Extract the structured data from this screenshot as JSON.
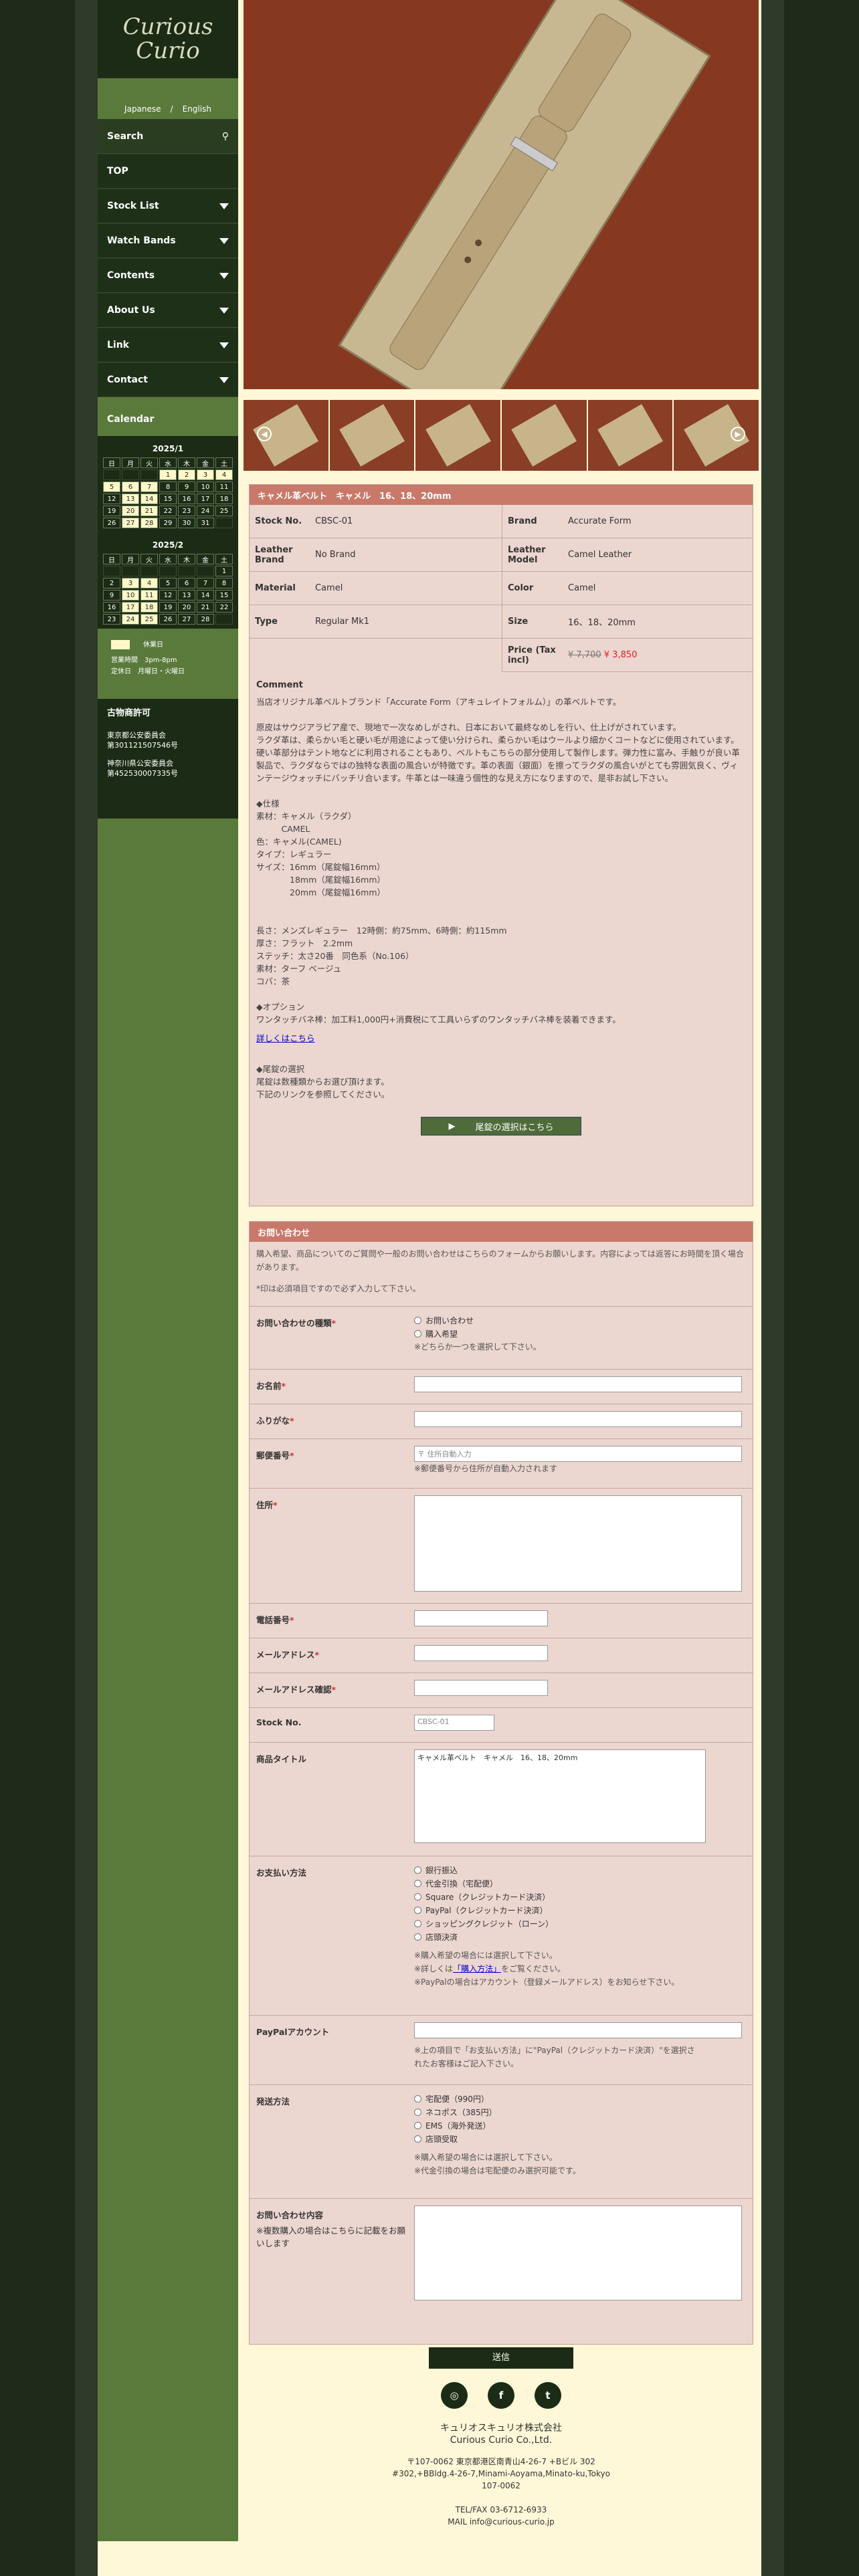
{
  "brand": {
    "line1": "Curious",
    "line2": "Curio"
  },
  "lang": {
    "ja": "Japanese",
    "sep": "/",
    "en": "English"
  },
  "nav": {
    "search": "Search",
    "top": "TOP",
    "stock": "Stock List",
    "watchbands": "Watch Bands",
    "contents": "Contents",
    "about": "About Us",
    "link": "Link",
    "contact": "Contact"
  },
  "calendar": {
    "heading": "Calendar",
    "month1": "2025/1",
    "month2": "2025/2",
    "weekdays": [
      "日",
      "月",
      "火",
      "水",
      "木",
      "金",
      "土"
    ],
    "m1": [
      "",
      "",
      "",
      "1",
      "2",
      "3",
      "4",
      "5",
      "6",
      "7",
      "8",
      "9",
      "10",
      "11",
      "12",
      "13",
      "14",
      "15",
      "16",
      "17",
      "18",
      "19",
      "20",
      "21",
      "22",
      "23",
      "24",
      "25",
      "26",
      "27",
      "28",
      "29",
      "30",
      "31",
      ""
    ],
    "m2": [
      "",
      "",
      "",
      "",
      "",
      "",
      "1",
      "2",
      "3",
      "4",
      "5",
      "6",
      "7",
      "8",
      "9",
      "10",
      "11",
      "12",
      "13",
      "14",
      "15",
      "16",
      "17",
      "18",
      "19",
      "20",
      "21",
      "22",
      "23",
      "24",
      "25",
      "26",
      "27",
      "28",
      ""
    ],
    "legend_holiday": "休業日",
    "hours_label": "営業時間",
    "hours": "3pm-8pm",
    "closed_label": "定休日",
    "closed": "月曜日・火曜日"
  },
  "kobutsu": {
    "title": "古物商許可",
    "l1": "東京都公安委員会",
    "l2": "第301121507546号",
    "l3": "神奈川県公安委員会",
    "l4": "第452530007335号"
  },
  "product": {
    "title": "キャメル革ベルト　キャメル　16、18、20mm",
    "stock_no_k": "Stock No.",
    "stock_no": "CBSC-01",
    "brand_k": "Brand",
    "brand": "Accurate Form",
    "leather_brand_k": "Leather Brand",
    "leather_brand": "No Brand",
    "leather_model_k": "Leather Model",
    "leather_model": "Camel Leather",
    "material_k": "Material",
    "material": "Camel",
    "color_k": "Color",
    "color": "Camel",
    "type_k": "Type",
    "type": "Regular Mk1",
    "size_k": "Size",
    "size": "16、18、20mm",
    "price_k": "Price (Tax incl)",
    "price_old": "¥ 7,700",
    "price_new": "¥ 3,850",
    "comment_h": "Comment",
    "comment": "当店オリジナル革ベルトブランド「Accurate Form（アキュレイトフォルム）」の革ベルトです。\n\n原皮はサウジアラビア産で、現地で一次なめしがされ、日本において最終なめしを行い、仕上げがされています。\nラクダ革は、柔らかい毛と硬い毛が用途によって使い分けられ、柔らかい毛はウールより細かくコートなどに使用されています。硬い革部分はテント地などに利用されることもあり、ベルトもこちらの部分使用して製作します。弾力性に富み、手触りが良い革製品で、ラクダならではの独特な表面の風合いが特徴です。革の表面（銀面）を擦ってラクダの風合いがとても雰囲気良く、ヴィンテージウォッチにバッチリ合います。牛革とは一味違う個性的な見え方になりますので、是非お試し下さい。\n\n◆仕様\n素材：キャメル（ラクダ）\n　　　CAMEL\n色：キャメル(CAMEL)\nタイプ：レギュラー\nサイズ：16mm（尾錠幅16mm）\n　　　　18mm（尾錠幅16mm）\n　　　　20mm（尾錠幅16mm）\n\n\n長さ：メンズレギュラー　12時側：約75mm、6時側：約115mm\n厚さ：フラット　2.2mm\nステッチ：太さ20番　同色系（No.106）\n素材：ターフ ベージュ\nコバ：茶\n\n◆オプション\nワンタッチバネ棒：加工料1,000円+消費税にて工具いらずのワンタッチバネ棒を装着できます。",
    "detail_link": "詳しくはこちら",
    "buckle": "◆尾錠の選択\n尾錠は数種類からお選び頂けます。\n下記のリンクを参照してください。",
    "buckle_btn": "尾錠の選択はこちら"
  },
  "form": {
    "heading": "お問い合わせ",
    "intro": "購入希望、商品についてのご質問や一般のお問い合わせはこちらのフォームからお願いします。内容によっては返答にお時間を頂く場合があります。",
    "req_note": "*印は必須項目ですので必ず入力して下さい。",
    "type_label": "お問い合わせの種類",
    "type_opt1": "お問い合わせ",
    "type_opt2": "購入希望",
    "type_note": "※どちらか一つを選択して下さい。",
    "name_label": "お名前",
    "kana_label": "ふりがな",
    "zip_label": "郵便番号",
    "zip_ph": "住所自動入力",
    "zip_note": "※郵便番号から住所が自動入力されます",
    "addr_label": "住所",
    "tel_label": "電話番号",
    "mail_label": "メールアドレス",
    "mail2_label": "メールアドレス確認",
    "stock_label": "Stock No.",
    "stock_val": "CBSC-01",
    "ptitle_label": "商品タイトル",
    "ptitle_val": "キャメル革ベルト　キャメル　16、18、20mm",
    "pay_label": "お支払い方法",
    "pay": [
      "銀行振込",
      "代金引換（宅配便）",
      "Square（クレジットカード決済）",
      "PayPal（クレジットカード決済）",
      "ショッピングクレジット（ローン）",
      "店頭決済"
    ],
    "pay_n1": "※購入希望の場合には選択して下さい。",
    "pay_n2a": "※詳しくは",
    "pay_n2b": "「購入方法」",
    "pay_n2c": "をご覧ください。",
    "pay_n3": "※PayPalの場合はアカウント（登録メールアドレス）をお知らせ下さい。",
    "paypal_label": "PayPalアカウント",
    "paypal_note": "※上の項目で「お支払い方法」に\"PayPal（クレジットカード決済）\"を選択されたお客様はご記入下さい。",
    "ship_label": "発送方法",
    "ship": [
      "宅配便（990円）",
      "ネコポス（385円）",
      "EMS（海外発送）",
      "店頭受取"
    ],
    "ship_n1": "※購入希望の場合には選択して下さい。",
    "ship_n2": "※代金引換の場合は宅配便のみ選択可能です。",
    "msg_label": "お問い合わせ内容",
    "msg_note": "※複数購入の場合はこちらに記載をお願いします",
    "submit": "送信"
  },
  "footer": {
    "company_ja": "キュリオスキュリオ株式会社",
    "company_en": "Curious Curio Co.,Ltd.",
    "addr_ja": "〒107-0062 東京都港区南青山4-26-7 +Bビル 302",
    "addr_en": "#302,+BBldg.4-26-7,Minami-Aoyama,Minato-ku,Tokyo",
    "zip": "107-0062",
    "tel": "TEL/FAX 03-6712-6933",
    "mail": "MAIL info@curious-curio.jp"
  }
}
